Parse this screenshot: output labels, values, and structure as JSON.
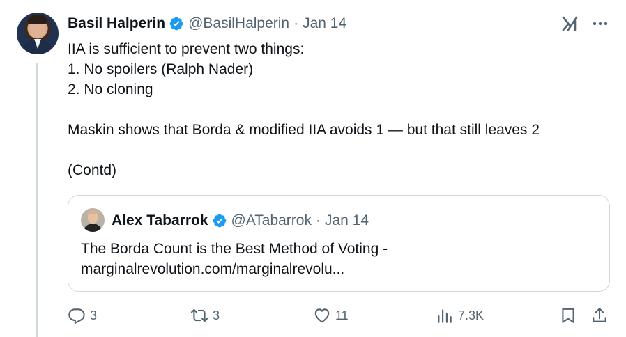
{
  "tweet": {
    "author_name": "Basil Halperin",
    "author_handle": "@BasilHalperin",
    "separator": "·",
    "date": "Jan 14",
    "lines": [
      "IIA is sufficient to prevent two things:",
      "1. No spoilers (Ralph Nader)",
      "2. No cloning",
      "",
      "Maskin shows that Borda & modified IIA avoids 1 — but that still leaves 2",
      "",
      "(Contd)"
    ],
    "top_icons": [
      "grok-icon",
      "more-icon"
    ]
  },
  "quote": {
    "author_name": "Alex Tabarrok",
    "author_handle": "@ATabarrok",
    "separator": "·",
    "date": "Jan 14",
    "lines": [
      "The Borda Count is the Best Method of Voting -",
      "marginalrevolution.com/marginalrevolu..."
    ]
  },
  "actions": {
    "reply_count": "3",
    "repost_count": "3",
    "like_count": "11",
    "views_count": "7.3K"
  },
  "colors": {
    "verified": "#1d9bf0",
    "secondary_text": "#536471",
    "border": "#cfd9de"
  }
}
